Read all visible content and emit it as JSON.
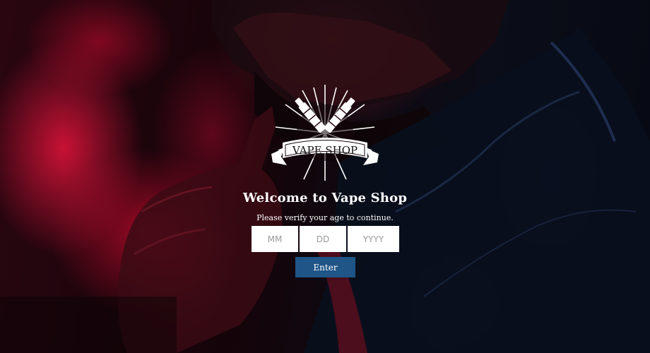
{
  "logo": {
    "text": "VAPE SHOP",
    "icon": "crossed-vape-pens-logo"
  },
  "gate": {
    "title": "Welcome to Vape Shop",
    "subtitle": "Please verify your age to continue.",
    "month_placeholder": "MM",
    "day_placeholder": "DD",
    "year_placeholder": "YYYY",
    "enter_label": "Enter"
  },
  "colors": {
    "button": "#1f5587",
    "smoke_red": "#e6143c",
    "background": "#07080d",
    "text": "#ffffff"
  }
}
